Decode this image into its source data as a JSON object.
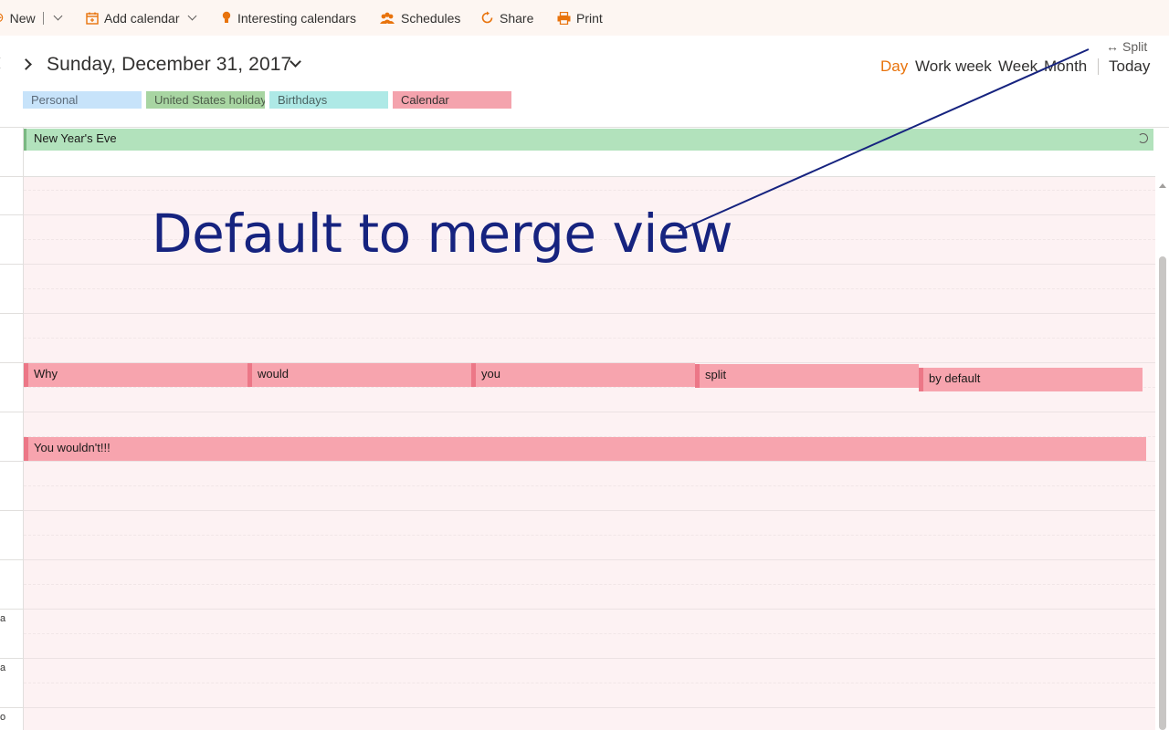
{
  "toolbar": {
    "new_label": "New",
    "add_calendar_label": "Add calendar",
    "interesting_label": "Interesting calendars",
    "schedules_label": "Schedules",
    "share_label": "Share",
    "print_label": "Print"
  },
  "header": {
    "date_title": "Sunday, December 31, 2017",
    "split_label": "Split",
    "views": {
      "day": "Day",
      "work_week": "Work week",
      "week": "Week",
      "month": "Month",
      "today": "Today"
    },
    "active_view": "Day"
  },
  "calendars": [
    {
      "name": "Personal",
      "color": "#c7e3fa"
    },
    {
      "name": "United States holidays",
      "color": "#a8d5a2"
    },
    {
      "name": "Birthdays",
      "color": "#aee9e6"
    },
    {
      "name": "Calendar",
      "color": "#f4a3ad"
    }
  ],
  "all_day_events": [
    {
      "title": "New Year's Eve",
      "recurring": true
    }
  ],
  "events": [
    {
      "title": "Why"
    },
    {
      "title": "would"
    },
    {
      "title": "you"
    },
    {
      "title": "split"
    },
    {
      "title": "by default"
    },
    {
      "title": "You wouldn't!!!"
    }
  ],
  "gutter_labels": [
    "a",
    "a",
    "o"
  ],
  "annotation": {
    "text": "Default to merge view",
    "color": "#16237f"
  },
  "colors": {
    "accent": "#e8730c",
    "event_fill": "#f7a4ae",
    "event_border": "#ec7787"
  }
}
